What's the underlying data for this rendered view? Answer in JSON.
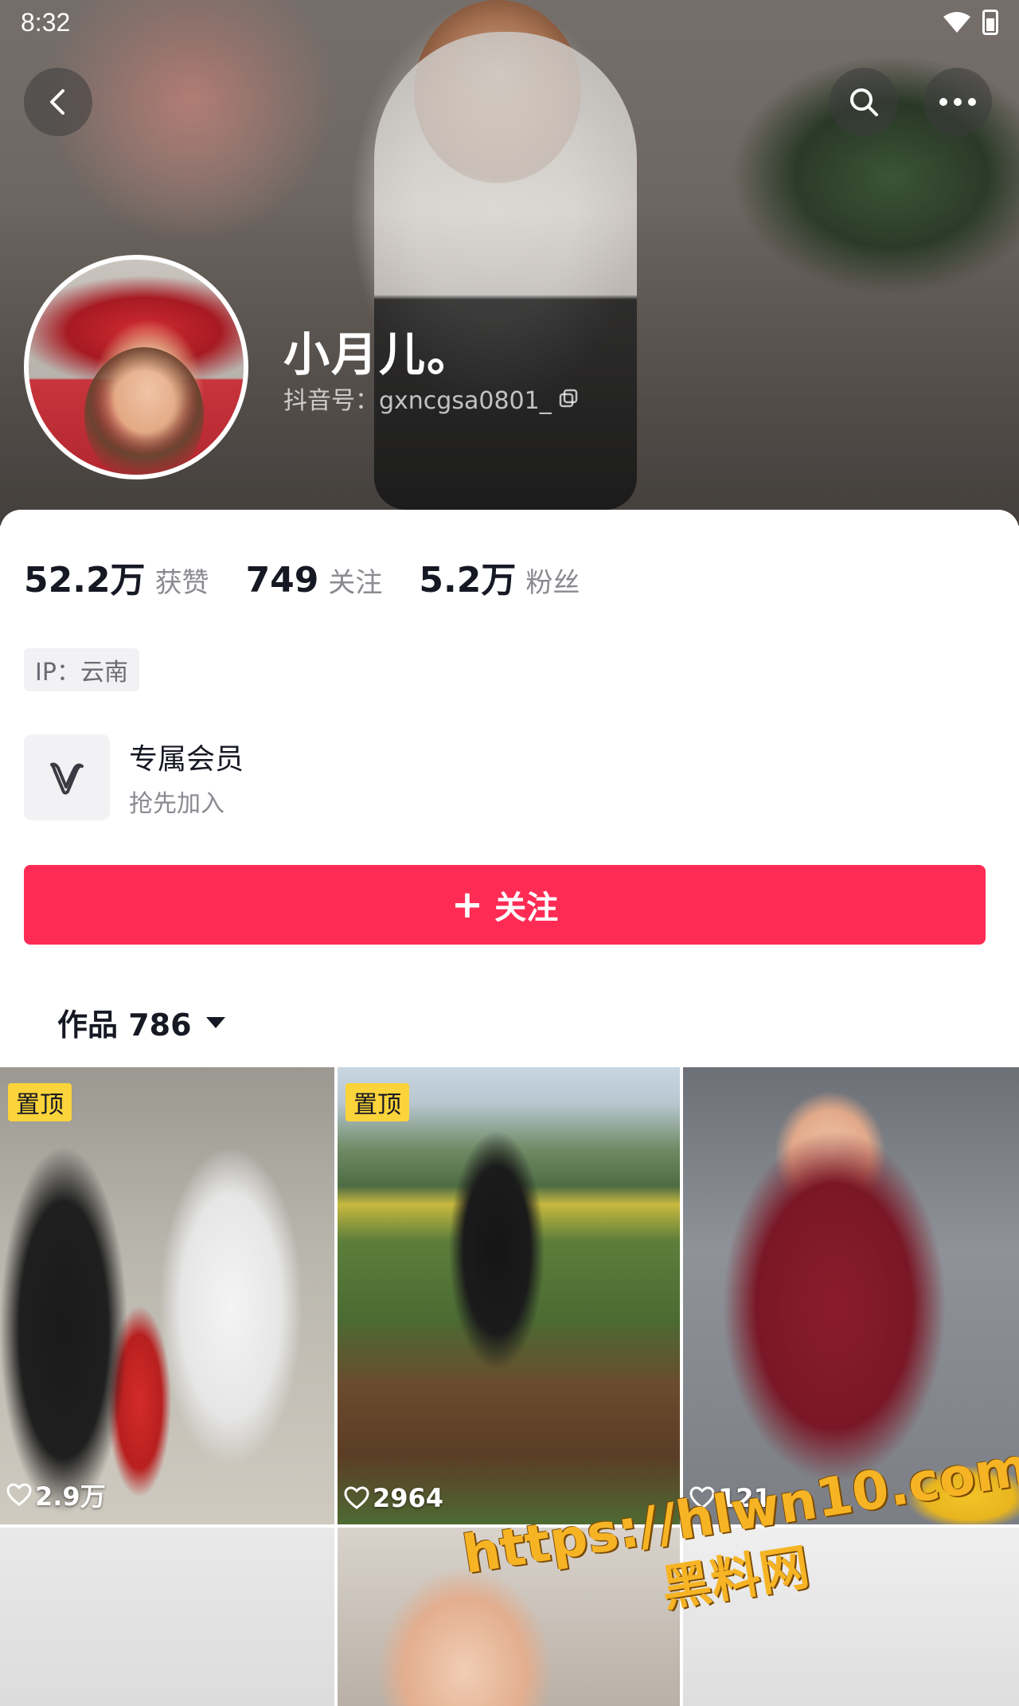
{
  "status_bar": {
    "time": "8:32"
  },
  "profile": {
    "nickname": "小月儿。",
    "douyin_id": "抖音号：gxncgsa0801_"
  },
  "stats": [
    {
      "value": "52.2万",
      "label": "获赞"
    },
    {
      "value": "749",
      "label": "关注"
    },
    {
      "value": "5.2万",
      "label": "粉丝"
    }
  ],
  "ip": "IP：云南",
  "membership": {
    "title": "专属会员",
    "subtitle": "抢先加入"
  },
  "follow_button": {
    "icon": "+",
    "label": "关注"
  },
  "works_tab": {
    "label": "作品 786"
  },
  "videos": [
    {
      "pinned": true,
      "pin_label": "置顶",
      "likes": "2.9万"
    },
    {
      "pinned": true,
      "pin_label": "置顶",
      "likes": "2964"
    },
    {
      "pinned": false,
      "likes": "121"
    }
  ],
  "watermark": {
    "url": "https://hlwn10.com",
    "name": "黑料网"
  },
  "colors": {
    "accent": "#fe2c55",
    "pin_badge": "#fbd33a",
    "watermark": "#f6b425"
  },
  "icons": [
    "back-icon",
    "search-icon",
    "more-icon",
    "copy-icon",
    "vip-logo-icon",
    "caret-down-icon",
    "heart-icon",
    "wifi-icon",
    "battery-icon"
  ]
}
